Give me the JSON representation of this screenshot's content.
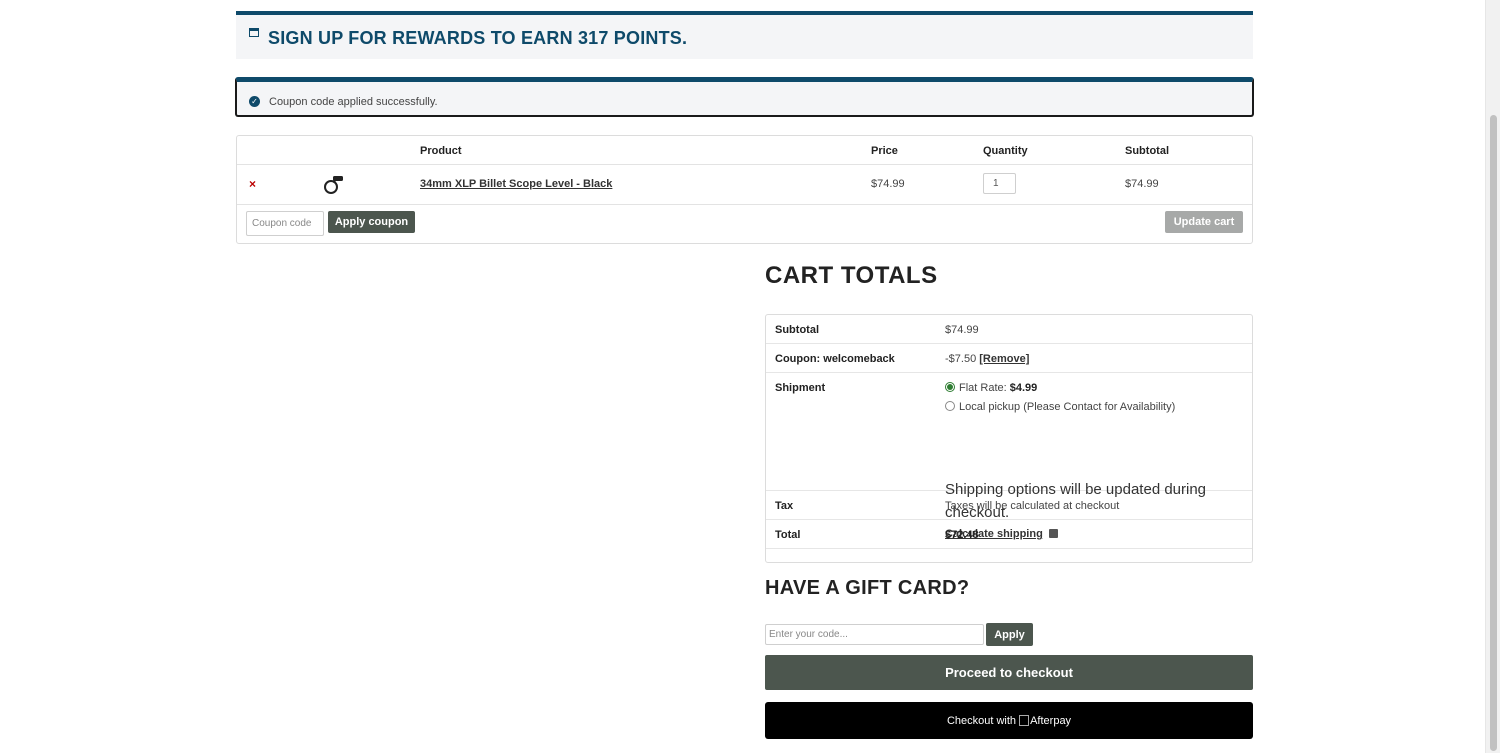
{
  "rewards": {
    "text": "SIGN UP FOR REWARDS TO EARN 317 POINTS."
  },
  "notice": {
    "text": "Coupon code applied successfully."
  },
  "cart_table": {
    "headers": {
      "product": "Product",
      "price": "Price",
      "quantity": "Quantity",
      "subtotal": "Subtotal"
    },
    "items": [
      {
        "remove": "×",
        "name": "34mm XLP Billet Scope Level - Black",
        "price": "$74.99",
        "quantity": "1",
        "subtotal": "$74.99"
      }
    ]
  },
  "actions": {
    "coupon_placeholder": "Coupon code",
    "apply_coupon": "Apply coupon",
    "update_cart": "Update cart"
  },
  "totals": {
    "title": "CART TOTALS",
    "subtotal_label": "Subtotal",
    "subtotal_value": "$74.99",
    "coupon_label": "Coupon: welcomeback",
    "coupon_value": "-$7.50",
    "coupon_remove": "[Remove]",
    "shipment_label": "Shipment",
    "flat_rate_label": "Flat Rate:",
    "flat_rate_price": "$4.99",
    "local_pickup": "Local pickup (Please Contact for Availability)",
    "ship_note": "Shipping options will be updated during checkout.",
    "calc_shipping": "Calculate shipping",
    "tax_label": "Tax",
    "tax_value": "Taxes will be calculated at checkout",
    "total_label": "Total",
    "total_value": "$72.48"
  },
  "gift": {
    "title": "HAVE A GIFT CARD?",
    "placeholder": "Enter your code...",
    "apply": "Apply"
  },
  "checkout": {
    "proceed": "Proceed to checkout",
    "afterpay_prefix": "Checkout with",
    "afterpay_brand": "Afterpay"
  }
}
